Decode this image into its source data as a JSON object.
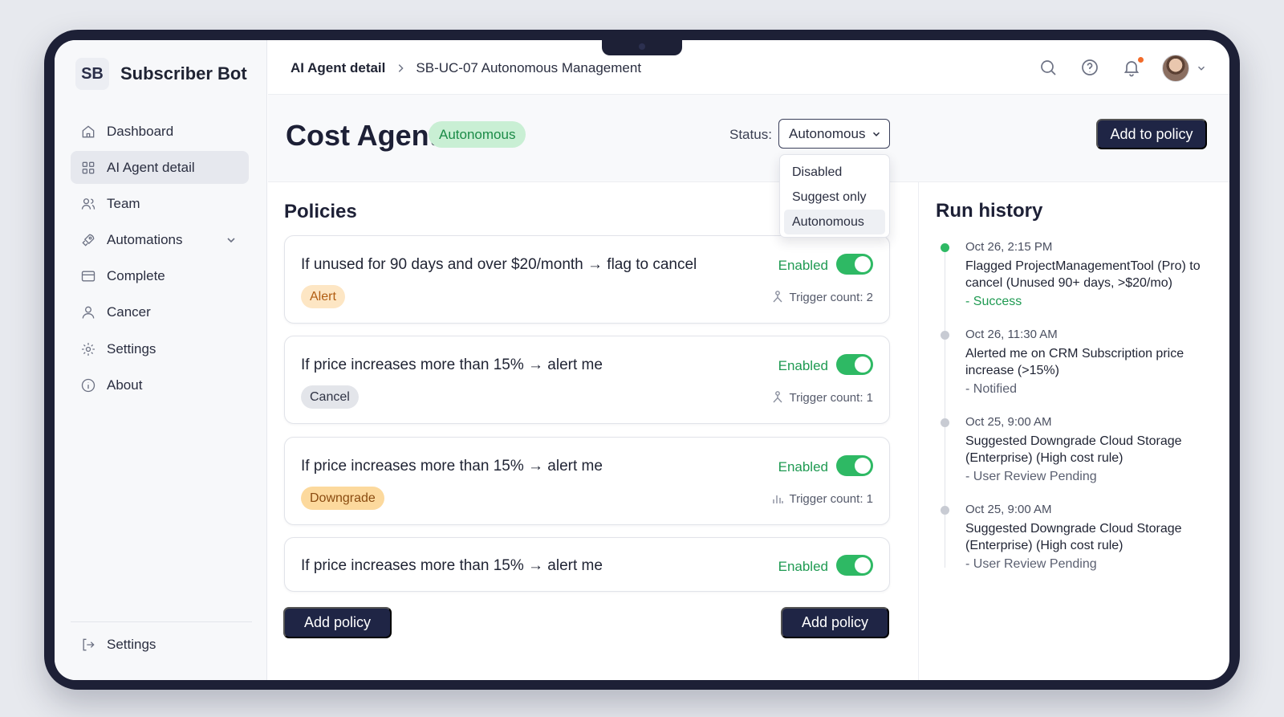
{
  "app": {
    "logo": "SB",
    "name": "Subscriber Bot"
  },
  "sidebar": {
    "items": [
      {
        "label": "Dashboard",
        "icon": "home-icon"
      },
      {
        "label": "AI Agent detail",
        "icon": "grid-icon",
        "active": true
      },
      {
        "label": "Team",
        "icon": "users-icon"
      },
      {
        "label": "Automations",
        "icon": "rocket-icon"
      },
      {
        "label": "Complete",
        "icon": "window-icon"
      },
      {
        "label": "Cancer",
        "icon": "user-icon"
      },
      {
        "label": "Settings",
        "icon": "gear-icon"
      },
      {
        "label": "About",
        "icon": "info-icon"
      }
    ],
    "footer_label": "Settings"
  },
  "breadcrumb": {
    "root": "AI Agent detail",
    "current": "SB-UC-07 Autonomous Management"
  },
  "header": {
    "title": "Cost Agent",
    "badge": "Autonomous",
    "status_label": "Status:",
    "status_value": "Autonomous",
    "add_to_policy": "Add to policy"
  },
  "status_options": [
    "Disabled",
    "Suggest only",
    "Autonomous"
  ],
  "policies": {
    "heading": "Policies",
    "items": [
      {
        "title": "If unused for 90 days and over $20/month → flag to cancel",
        "state": "Enabled",
        "enabled": true,
        "tag": "Alert",
        "trigger": "Trigger count: 2"
      },
      {
        "title": "If price increases more than 15% → alert me",
        "state": "Enabled",
        "enabled": true,
        "tag": "Cancel",
        "trigger": "Trigger count: 1"
      },
      {
        "title": "If price increases more than 15% → alert me",
        "state": "Enabled",
        "enabled": true,
        "tag": "Downgrade",
        "trigger": "Trigger count: 1"
      },
      {
        "title": "If price increases more than 15% → alert me",
        "state": "Enabled",
        "enabled": true
      }
    ],
    "add_left": "Add policy",
    "add_right": "Add policy"
  },
  "history": {
    "heading": "Run history",
    "items": [
      {
        "time": "Oct 26, 2:15 PM",
        "text": "Flagged ProjectManagementTool (Pro) to cancel (Unused 90+ days, >$20/mo)",
        "status": "- Success"
      },
      {
        "time": "Oct 26, 11:30 AM",
        "text": "Alerted me on CRM Subscription price increase (>15%)",
        "status": "- Notified"
      },
      {
        "time": "Oct 25, 9:00 AM",
        "text": "Suggested Downgrade Cloud Storage (Enterprise) (High cost rule)",
        "status": "- User Review Pending"
      },
      {
        "time": "Oct 25, 9:00 AM",
        "text": "Suggested Downgrade Cloud Storage (Enterprise) (High cost rule)",
        "status": "- User Review Pending"
      }
    ]
  },
  "colors": {
    "accent_dark": "#1f2545",
    "success": "#2eb964",
    "alert_tag": "#fde6c4",
    "downgrade_tag": "#fcd99d"
  }
}
